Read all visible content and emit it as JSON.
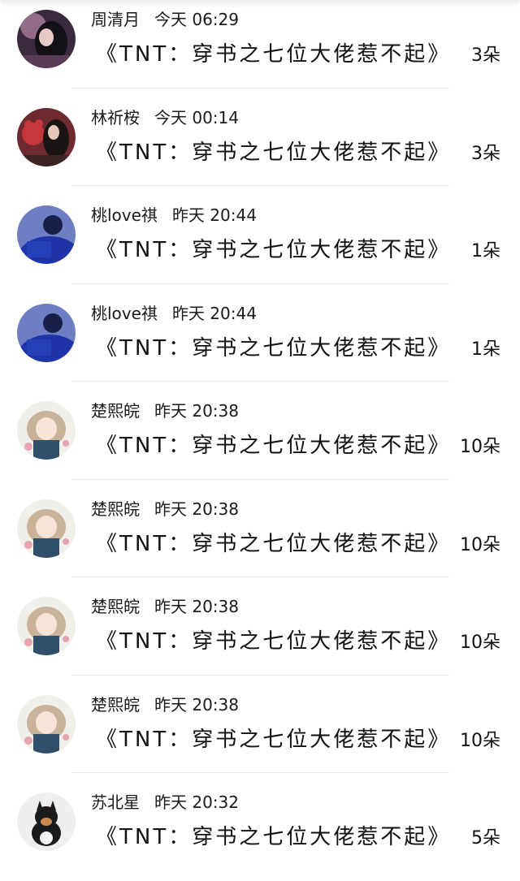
{
  "gifts": [
    {
      "name": "周清月",
      "time": "今天 06:29",
      "title": "《TNT：穿书之七位大佬惹不起》",
      "count": "3朵",
      "avatar": "dark-girl-avatar"
    },
    {
      "name": "林祈桉",
      "time": "今天 00:14",
      "title": "《TNT：穿书之七位大佬惹不起》",
      "count": "3朵",
      "avatar": "girl-with-red-bear-avatar"
    },
    {
      "name": "桃love祺",
      "time": "昨天 20:44",
      "title": "《TNT：穿书之七位大佬惹不起》",
      "count": "1朵",
      "avatar": "blue-silhouette-avatar"
    },
    {
      "name": "桃love祺",
      "time": "昨天 20:44",
      "title": "《TNT：穿书之七位大佬惹不起》",
      "count": "1朵",
      "avatar": "blue-silhouette-avatar"
    },
    {
      "name": "楚熙皖",
      "time": "昨天 20:38",
      "title": "《TNT：穿书之七位大佬惹不起》",
      "count": "10朵",
      "avatar": "anime-girl-flowers-avatar"
    },
    {
      "name": "楚熙皖",
      "time": "昨天 20:38",
      "title": "《TNT：穿书之七位大佬惹不起》",
      "count": "10朵",
      "avatar": "anime-girl-flowers-avatar"
    },
    {
      "name": "楚熙皖",
      "time": "昨天 20:38",
      "title": "《TNT：穿书之七位大佬惹不起》",
      "count": "10朵",
      "avatar": "anime-girl-flowers-avatar"
    },
    {
      "name": "楚熙皖",
      "time": "昨天 20:38",
      "title": "《TNT：穿书之七位大佬惹不起》",
      "count": "10朵",
      "avatar": "anime-girl-flowers-avatar"
    },
    {
      "name": "苏北星",
      "time": "昨天 20:32",
      "title": "《TNT：穿书之七位大佬惹不起》",
      "count": "5朵",
      "avatar": "shiba-dog-avatar"
    }
  ]
}
